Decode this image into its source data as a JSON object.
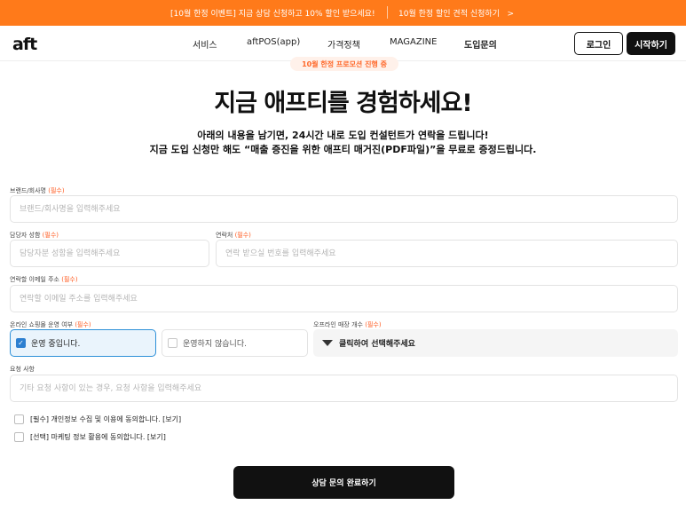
{
  "topbar": {
    "promo_left": "[10월 한정 이벤트] 지금 상담 신청하고 10% 할인 받으세요!",
    "promo_right": "10월 한정 할인 견적 신청하기   >"
  },
  "nav": {
    "logo": "aft",
    "items": [
      "서비스",
      "aftPOS(app)",
      "가격정책",
      "MAGAZINE",
      "도입문의"
    ],
    "login_label": "로그인",
    "start_label": "시작하기"
  },
  "hero": {
    "badge": "10월 한정 프로모션 진행 중",
    "title": "지금 애프티를 경험하세요!",
    "subtitle1": "아래의 내용을 남기면, 24시간 내로 도입 컨설턴트가 연락을 드립니다!",
    "subtitle2": "지금 도입 신청만 해도 “매출 증진을 위한 애프티 매거진(PDF파일)”을 무료로 증정드립니다."
  },
  "form": {
    "required_mark": "(필수)",
    "brand": {
      "label": "브랜드/회사명",
      "placeholder": "브랜드/회사명을 입력해주세요"
    },
    "manager": {
      "label": "담당자 성함",
      "placeholder": "담당자분 성함을 입력해주세요"
    },
    "phone": {
      "label": "연락처",
      "placeholder": "연락 받으실 번호를 입력해주세요"
    },
    "email": {
      "label": "연락할 이메일 주소",
      "placeholder": "연락할 이메일 주소를 입력해주세요"
    },
    "online_store": {
      "label": "온라인 쇼핑몰 운영 여부",
      "option_yes": "운영 중입니다.",
      "option_no": "운영하지 않습니다.",
      "selected": "yes"
    },
    "offline_count": {
      "label": "오프라인 매장 개수",
      "value": "클릭하여 선택해주세요"
    },
    "request": {
      "label": "요청 사항",
      "placeholder": "기타 요청 사항이 있는 경우, 요청 사항을 입력해주세요"
    },
    "agree_privacy": "[필수] 개인정보 수집 및 이용에 동의합니다. [보기]",
    "agree_marketing": "[선택] 마케팅 정보 활용에 동의합니다. [보기]",
    "submit_label": "상담 문의 완료하기",
    "check_glyph": "✓"
  },
  "colors": {
    "accent_orange": "#ff7a1a",
    "selected_blue": "#2d90d8",
    "dark": "#111111"
  }
}
